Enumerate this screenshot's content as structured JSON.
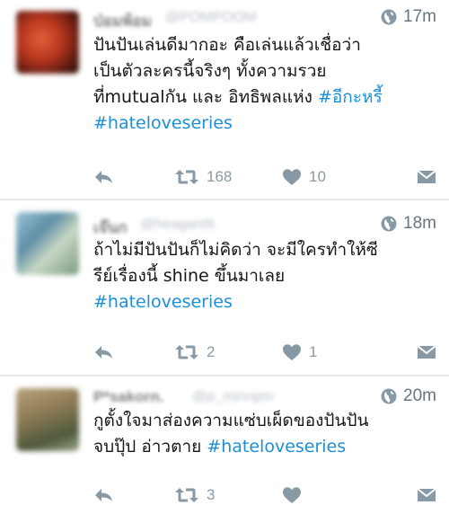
{
  "tweets": [
    {
      "author_name": "ป่อมพ้อม",
      "handle": "@POMPOOM",
      "time": "17m",
      "lines": [
        {
          "text": "ปันปันเล่นดีมากอะ คือเล่นแล้วเชื่อว่า",
          "hashtag": ""
        },
        {
          "text": "เป็นตัวละครนี้จริงๆ ทั้งความรวย",
          "hashtag": ""
        },
        {
          "text": "ที่mutualกัน และ อิทธิพลแห่ง ",
          "hashtag": "#อีกะหรี้"
        },
        {
          "text": "",
          "hashtag": "#hateloveseries"
        }
      ],
      "retweets": "168",
      "likes": "10"
    },
    {
      "author_name": "เจ๊นก",
      "handle": "@heaganttt",
      "time": "18m",
      "lines": [
        {
          "text": "ถ้าไม่มีปันปันก็ไม่คิดว่า จะมีใครทำให้ซี",
          "hashtag": ""
        },
        {
          "text": "รีย์เรื่องนี้ shine ขึ้นมาเลย",
          "hashtag": ""
        },
        {
          "text": "",
          "hashtag": "#hateloveseries"
        }
      ],
      "retweets": "2",
      "likes": "1"
    },
    {
      "author_name": "P*sakorn.",
      "handle": "@p_minnpm",
      "time": "20m",
      "lines": [
        {
          "text": "กูตั้งใจมาส่องความแซ่บเผ็ดของปันปัน",
          "hashtag": ""
        },
        {
          "text": "จบปุ๊ป อ่าวตาย ",
          "hashtag": "#hateloveseries"
        }
      ],
      "retweets": "3",
      "likes": ""
    }
  ],
  "icons": {
    "time": "globe-icon",
    "reply": "reply-arrow-icon",
    "retweet": "retweet-icon",
    "like": "heart-icon",
    "dm": "envelope-icon"
  },
  "colors": {
    "hashtag": "#1d8fd6",
    "icon": "#8899a6",
    "timestamp": "#66757f",
    "divider": "#e1e8ed"
  }
}
